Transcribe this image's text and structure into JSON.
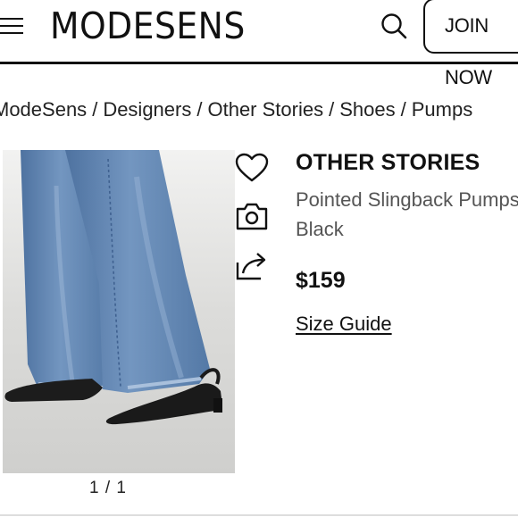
{
  "header": {
    "logo": "MODESENS",
    "menu_icon": "menu-icon",
    "search_icon": "search-icon",
    "join_label": "JOIN NOW"
  },
  "breadcrumb": [
    "ModeSens",
    "Designers",
    "Other Stories",
    "Shoes",
    "Pumps"
  ],
  "gallery": {
    "counter": "1 / 1"
  },
  "actions": {
    "wishlist_icon": "heart-icon",
    "camera_icon": "camera-icon",
    "share_icon": "share-icon"
  },
  "product": {
    "brand": "OTHER STORIES",
    "name_line1": "Pointed Slingback Pumps",
    "name_line2": "Black",
    "price": "$159",
    "size_guide": "Size Guide"
  },
  "colors": {
    "text": "#111111",
    "secondary_text": "#555555",
    "denim": "#5b7fa8",
    "floor": "#d4d4d2"
  }
}
